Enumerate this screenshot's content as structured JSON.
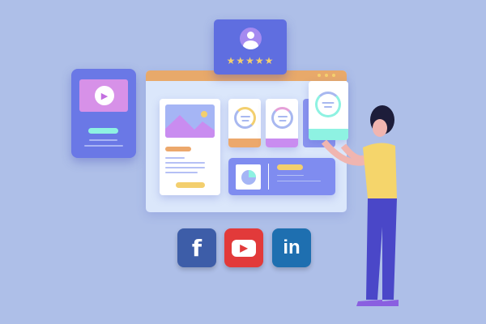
{
  "profile_card": {
    "star_count": 5,
    "star_glyph": "★"
  },
  "social": [
    {
      "name": "facebook",
      "glyph": "f",
      "color": "#3d5da8"
    },
    {
      "name": "youtube",
      "glyph": "▶",
      "color": "#e23a3a"
    },
    {
      "name": "linkedin",
      "glyph": "in",
      "color": "#1e6fb0"
    }
  ],
  "colors": {
    "background": "#aebfe8",
    "window_bar": "#e8a96a",
    "accent": "#6470e0"
  }
}
